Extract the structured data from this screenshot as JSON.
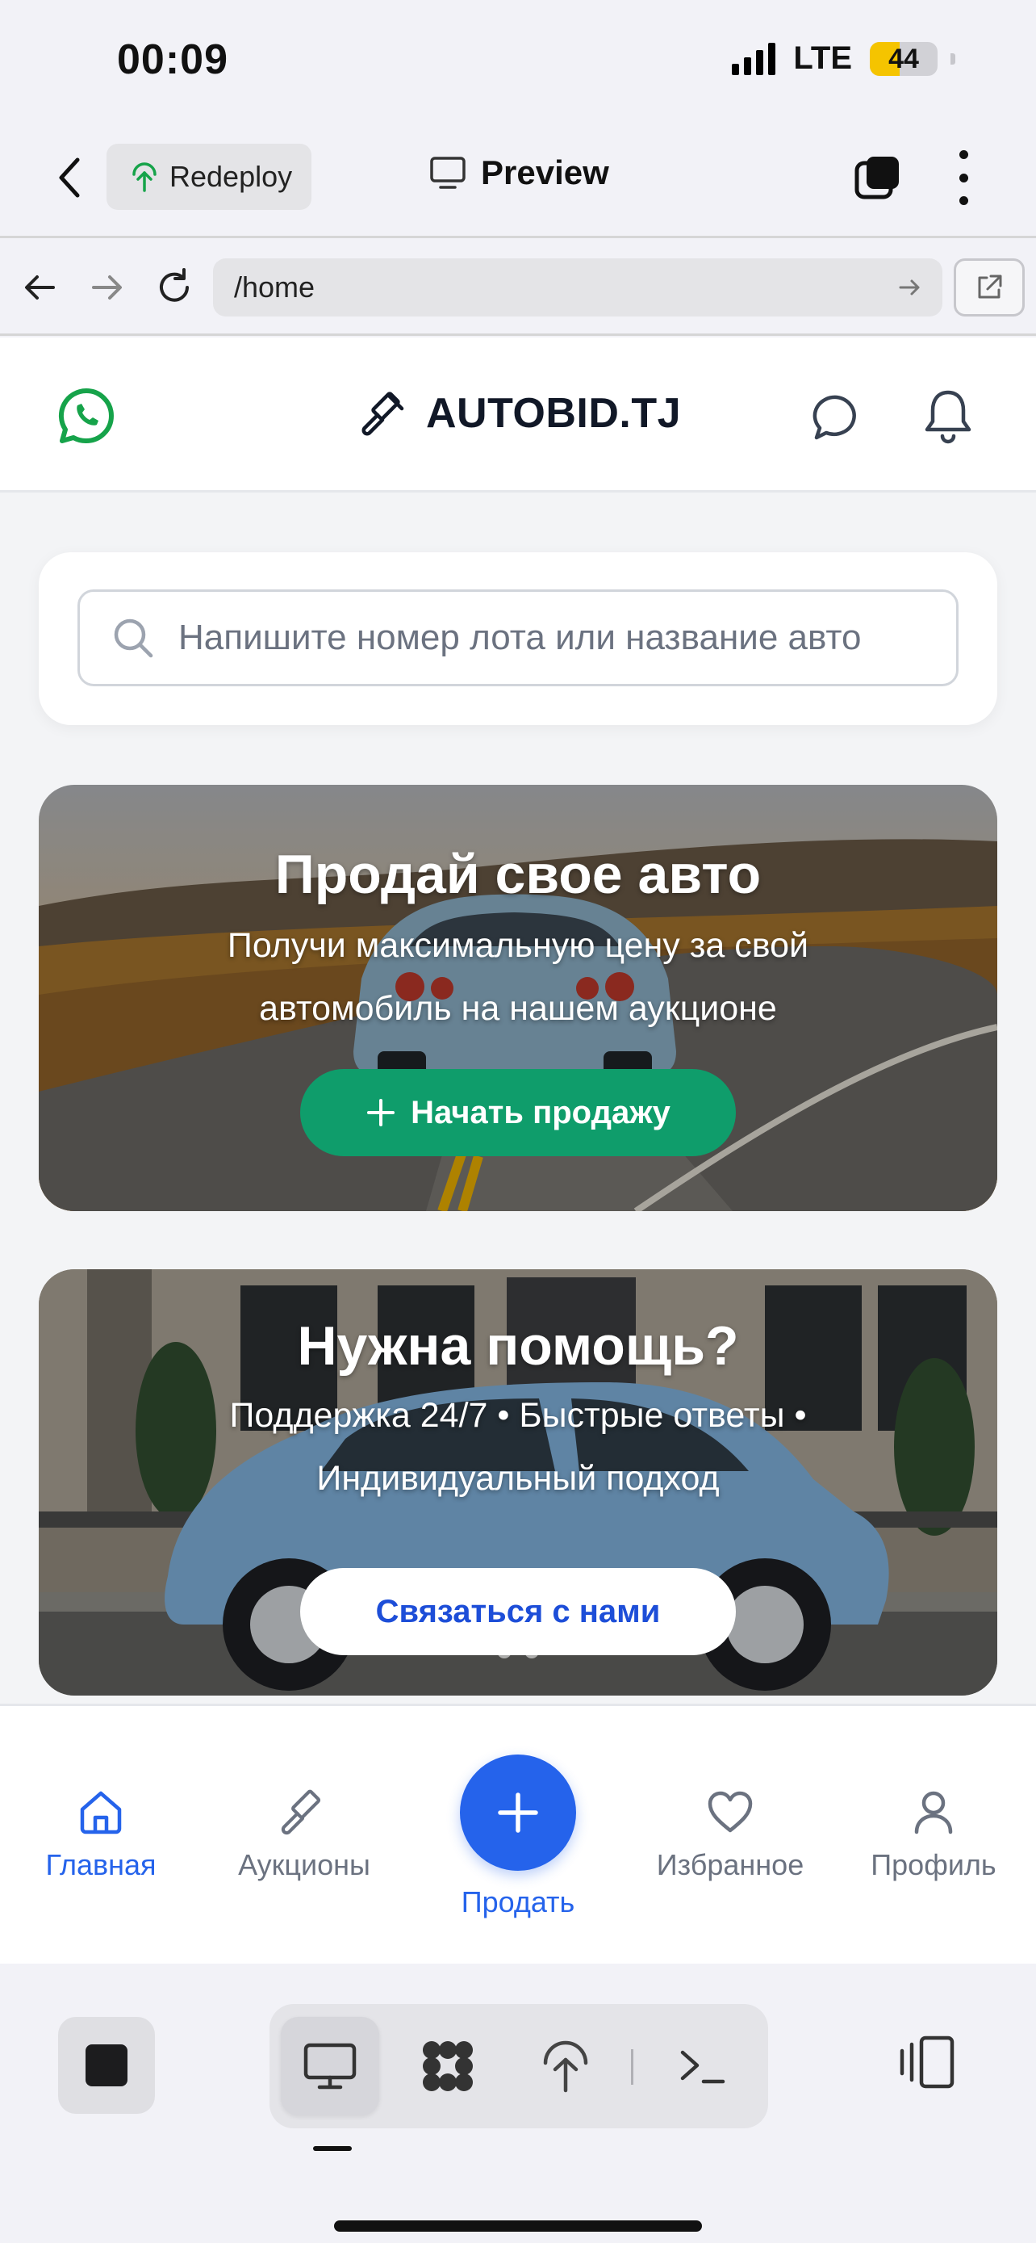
{
  "status_bar": {
    "time": "00:09",
    "network": "LTE",
    "battery_percent": 44
  },
  "replit_bar": {
    "redeploy_label": "Redeploy",
    "preview_label": "Preview"
  },
  "url_bar": {
    "url": "/home"
  },
  "app_header": {
    "brand": "AUTOBID.TJ",
    "brand_color": "#111827",
    "whatsapp_color": "#16a34a"
  },
  "search": {
    "placeholder": "Напишите номер лота или название авто"
  },
  "banners": [
    {
      "title": "Продай свое авто",
      "subtitle": "Получи максимальную цену за свой автомобиль на нашем аукционе",
      "button_label": "Начать продажу",
      "button_color": "#0f9d6b"
    },
    {
      "title": "Нужна помощь?",
      "subtitle": "Поддержка 24/7 • Быстрые ответы • Индивидуальный подход",
      "button_label": "Связаться с нами",
      "button_text_color": "#1d4ed8"
    }
  ],
  "bottom_nav": {
    "items": [
      {
        "label": "Главная",
        "icon": "home-icon",
        "active": true
      },
      {
        "label": "Аукционы",
        "icon": "gavel-icon",
        "active": false
      },
      {
        "label": "Продать",
        "icon": "plus-icon",
        "active": false
      },
      {
        "label": "Избранное",
        "icon": "heart-icon",
        "active": false
      },
      {
        "label": "Профиль",
        "icon": "user-icon",
        "active": false
      }
    ],
    "accent": "#2563eb",
    "inactive": "#6b7280"
  }
}
